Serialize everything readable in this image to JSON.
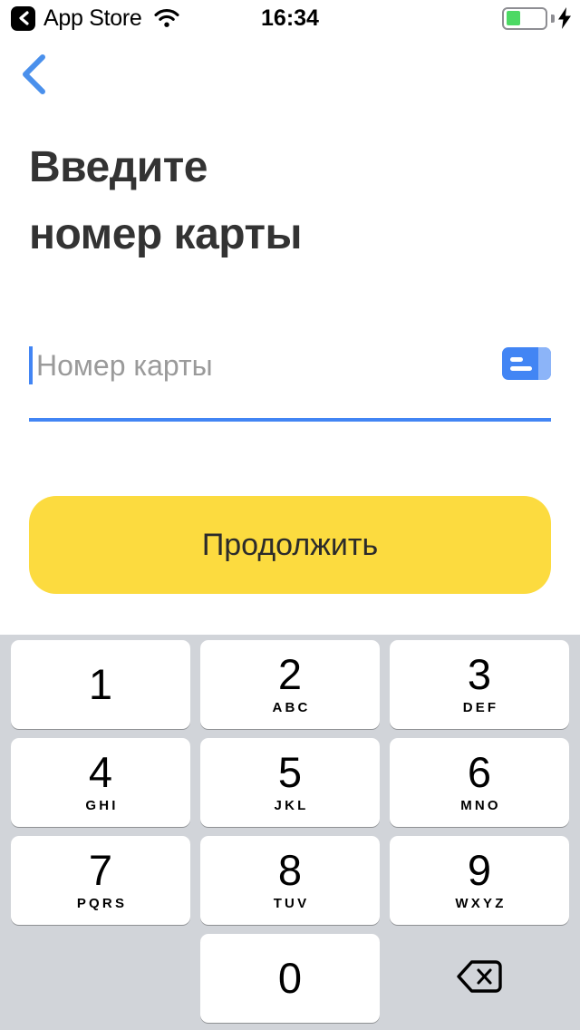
{
  "status_bar": {
    "back_badge_icon": "chevron-left-icon",
    "app_label": "App Store",
    "wifi_icon": "wifi-icon",
    "time": "16:34",
    "battery_icon": "battery-icon",
    "battery_level_percent": 38,
    "charging_icon": "lightning-bolt-icon"
  },
  "nav": {
    "back_icon": "chevron-left-icon"
  },
  "page": {
    "title_line1": "Введите",
    "title_line2": "номер карты"
  },
  "card_field": {
    "placeholder": "Номер карты",
    "value": "",
    "scan_icon": "card-icon"
  },
  "cta": {
    "label": "Продолжить"
  },
  "keyboard": {
    "rows": [
      [
        {
          "digit": "1",
          "letters": ""
        },
        {
          "digit": "2",
          "letters": "ABC"
        },
        {
          "digit": "3",
          "letters": "DEF"
        }
      ],
      [
        {
          "digit": "4",
          "letters": "GHI"
        },
        {
          "digit": "5",
          "letters": "JKL"
        },
        {
          "digit": "6",
          "letters": "MNO"
        }
      ],
      [
        {
          "digit": "7",
          "letters": "PQRS"
        },
        {
          "digit": "8",
          "letters": "TUV"
        },
        {
          "digit": "9",
          "letters": "WXYZ"
        }
      ],
      [
        {
          "digit": "0",
          "letters": ""
        }
      ]
    ],
    "backspace_icon": "backspace-icon"
  },
  "colors": {
    "accent_blue": "#4285f4",
    "cta_yellow": "#fcdb3f",
    "keyboard_bg": "#d1d4d9",
    "title_text": "#333333",
    "placeholder_text": "#9a9a9a",
    "battery_green": "#4cd964"
  }
}
